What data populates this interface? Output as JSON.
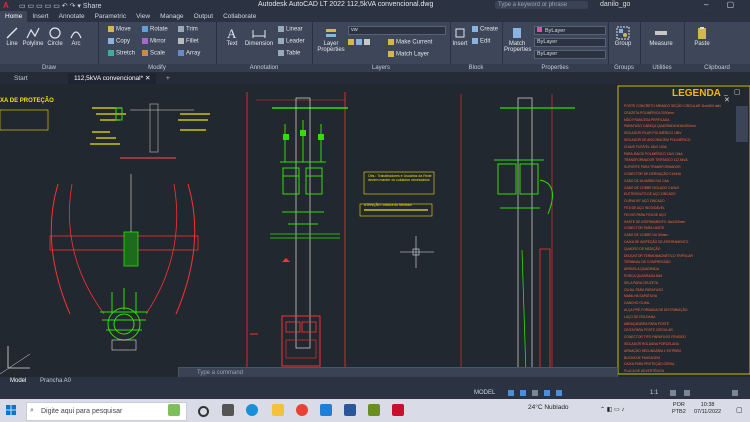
{
  "titlebar": {
    "logo": "A",
    "qat": "▭ ▭ ▭ ▭ ▭ ↶ ↷ ▾ Share",
    "title": "Autodesk AutoCAD LT 2022   112,5kVA convencional.dwg",
    "search_placeholder": "Type a keyword or phrase",
    "user": "danilo_go",
    "window_buttons": "– ▢ ✕"
  },
  "ribbon_tabs": [
    "Home",
    "Insert",
    "Annotate",
    "Parametric",
    "View",
    "Manage",
    "Output",
    "Collaborate"
  ],
  "ribbon": {
    "draw": {
      "name": "Draw",
      "tools": [
        "Line",
        "Polyline",
        "Circle",
        "Arc"
      ]
    },
    "modify": {
      "name": "Modify",
      "tools": [
        "Move",
        "Rotate",
        "Trim",
        "Copy",
        "Mirror",
        "Fillet",
        "Stretch",
        "Scale",
        "Array"
      ]
    },
    "annotation": {
      "name": "Annotation",
      "text": "Text",
      "dimension": "Dimension",
      "linear": "Linear",
      "leader": "Leader",
      "table": "Table"
    },
    "layers": {
      "name": "Layers",
      "layer_props": "Layer Properties",
      "current_layer": "vw",
      "make_current": "Make Current",
      "match_layer": "Match Layer"
    },
    "block": {
      "name": "Block",
      "insert": "Insert",
      "create": "Create",
      "edit": "Edit"
    },
    "properties": {
      "name": "Properties",
      "match": "Match Properties",
      "color": "ByLayer",
      "linetype": "ByLayer",
      "lineweight": "ByLayer"
    },
    "groups": {
      "name": "Groups",
      "group": "Group"
    },
    "utilities": {
      "name": "Utilities",
      "measure": "Measure"
    },
    "clipboard": {
      "name": "Clipboard",
      "paste": "Paste"
    }
  },
  "file_tabs": {
    "start": "Start",
    "active": "112,5kVA convencional*",
    "close": "✕",
    "add": "+"
  },
  "drawing": {
    "left_title": "XA DE PROTEÇÃO",
    "legend_title": "LEGENDA",
    "legend_controls": "_ ▢ ✕",
    "legend_items": [
      "POSTE CONCRETO ARMADO SEÇÃO CIRCULAR 11m/600 daN",
      "CRUZETA POLIMÉRICA 2000mm",
      "MÃO FRANCESA PERFILADA",
      "PARAFUSO CABEÇA QUADRADA M16x200mm",
      "ISOLADOR PILAR POLIMÉRICO 15kV",
      "ISOLADOR DE ANCORAGEM POLIMÉRICO",
      "CHAVE FUSÍVEL 15kV 100A",
      "PARA-RAIOS POLIMÉRICO 12kV 10kA",
      "TRANSFORMADOR TRIFÁSICO 112,5kVA",
      "SUPORTE PARA TRANSFORMADOR",
      "CONECTOR DE DERIVAÇÃO CUNHA",
      "CABO DE ALUMÍNIO NU CAA",
      "CABO DE COBRE ISOLADO 0,6/1kV",
      "ELETRODUTO DE AÇO ZINCADO",
      "CURVA 90° AÇO ZINCADO",
      "FITA DE AÇO INOXIDÁVEL",
      "FECHO PARA FITA DE AÇO",
      "HASTE DE ATERRAMENTO 16x2400mm",
      "CONECTOR PARA HASTE",
      "CABO DE COBRE NU 50mm²",
      "CAIXA DE INSPEÇÃO DE ATERRAMENTO",
      "QUADRO DE MEDIÇÃO",
      "DISJUNTOR TERMOMAGNÉTICO TRIPOLAR",
      "TERMINAL DE COMPRESSÃO",
      "ARRUELA QUADRADA",
      "PORCA QUADRADA M16",
      "SELA PARA CRUZETA",
      "OLHAL PARA PARAFUSO",
      "MANILHA SAPATILHA",
      "GANCHO OLHAL",
      "ALÇA PRÉ-FORMADA DE DISTRIBUIÇÃO",
      "LAÇO DE ROLDANA",
      "ABRAÇADEIRA PARA POSTE",
      "CINTA PARA POSTE CIRCULAR",
      "CONECTOR TIPO PARAFUSO FENDIDO",
      "ISOLADOR ROLDANA PORCELANA",
      "ARMAÇÃO SECUNDÁRIA 1 ESTRIBO",
      "BUCHA DE PASSAGEM",
      "CAIXA PARA PROTEÇÃO GERAL",
      "PLACA DE ADVERTÊNCIA"
    ],
    "note1": "Obs.: Trabalhadores e Usuários da Rede devem manter os cuidados necessários",
    "note2": "ATENÇÃO: Leitura do Medidor"
  },
  "command_line": {
    "placeholder": "Type a command"
  },
  "layout_tabs": [
    "Model",
    "Prancha A0"
  ],
  "status": {
    "model": "MODEL",
    "scale": "1:1"
  },
  "taskbar": {
    "search": "Digite aqui para pesquisar",
    "weather": "24°C  Nublado",
    "lang1": "POR",
    "lang2": "PTB2",
    "time": "10:38",
    "date": "07/11/2022"
  }
}
